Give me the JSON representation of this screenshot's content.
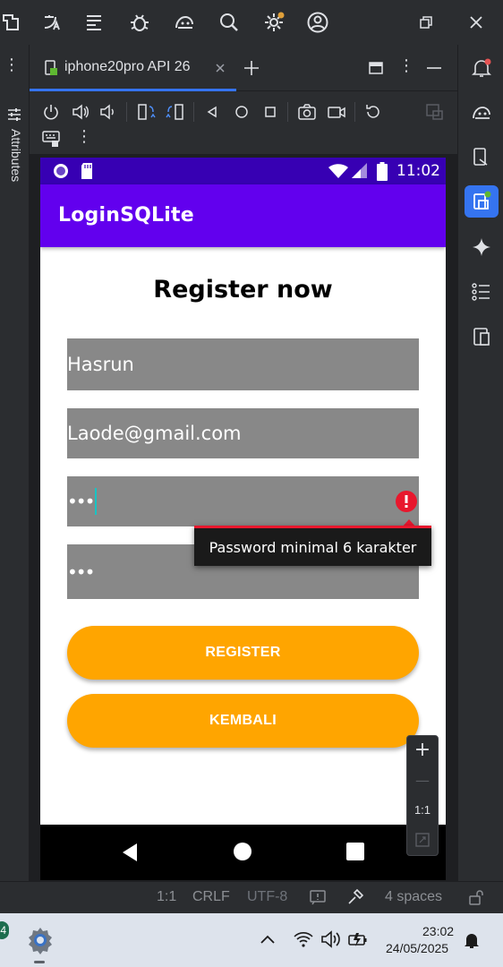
{
  "ide": {
    "tab_label": "iphone20pro API 26",
    "side_panel_label": "Attributes",
    "colors": {
      "bg": "#2b2d30",
      "accent": "#3574f0",
      "notify_dot": "#e0a03a"
    }
  },
  "device": {
    "status_time": "11:02",
    "app_title": "LoginSQLite",
    "heading": "Register now",
    "fields": {
      "name_value": "Hasrun",
      "email_value": "Laode@gmail.com",
      "password_mask": "•••",
      "confirm_mask": "•••"
    },
    "error_tooltip": "Password minimal 6 karakter",
    "register_label": "REGISTER",
    "back_label": "KEMBALI",
    "colors": {
      "status": "#3700b3",
      "appbar": "#6200ee",
      "button": "#ffa500",
      "field": "#888888",
      "error": "#e8172d"
    }
  },
  "zoom_controls": {
    "plus": "+",
    "minus": "—",
    "one_to_one": "1:1"
  },
  "status_strip": {
    "position": "1:1",
    "line_sep": "CRLF",
    "encoding": "UTF-8",
    "indent": "4 spaces"
  },
  "taskbar": {
    "badge": "4",
    "time": "23:02",
    "date": "24/05/2025"
  }
}
